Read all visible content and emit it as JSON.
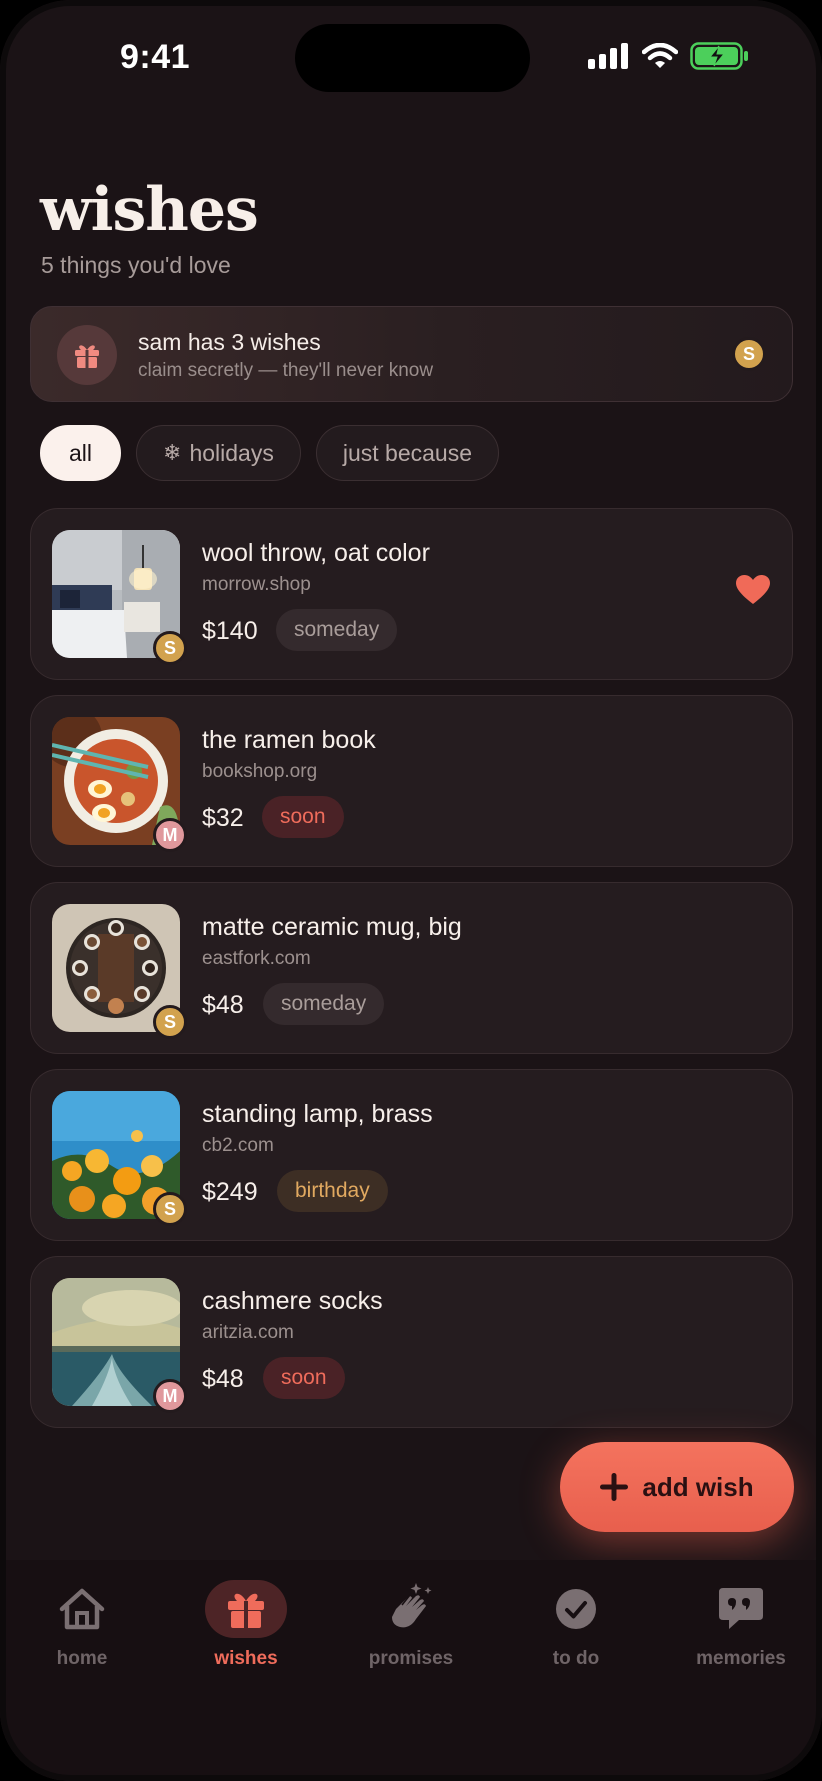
{
  "status": {
    "time": "9:41"
  },
  "header": {
    "title": "wishes",
    "subtitle": "5 things you'd love"
  },
  "banner": {
    "title": "sam has 3 wishes",
    "subtitle": "claim secretly — they'll never know",
    "avatar": "S"
  },
  "filters": [
    {
      "label": "all",
      "active": true
    },
    {
      "label": "holidays",
      "icon": "❄"
    },
    {
      "label": "just because"
    }
  ],
  "wishes": [
    {
      "name": "wool throw, oat color",
      "store": "morrow.shop",
      "price": "$140",
      "tag": "someday",
      "owner": "S",
      "favorited": true,
      "image": "bedroom-photo"
    },
    {
      "name": "the ramen book",
      "store": "bookshop.org",
      "price": "$32",
      "tag": "soon",
      "owner": "M",
      "image": "ramen-photo"
    },
    {
      "name": "matte ceramic mug, big",
      "store": "eastfork.com",
      "price": "$48",
      "tag": "someday",
      "owner": "S",
      "image": "coffee-table-photo"
    },
    {
      "name": "standing lamp, brass",
      "store": "cb2.com",
      "price": "$249",
      "tag": "birthday",
      "owner": "S",
      "image": "flowers-photo"
    },
    {
      "name": "cashmere socks",
      "store": "aritzia.com",
      "price": "$48",
      "tag": "soon",
      "owner": "M",
      "image": "sea-photo"
    }
  ],
  "add_button": {
    "label": "add wish"
  },
  "tabs": [
    {
      "label": "home",
      "icon": "home-icon"
    },
    {
      "label": "wishes",
      "icon": "gift-icon",
      "active": true
    },
    {
      "label": "promises",
      "icon": "clapping-hands-icon"
    },
    {
      "label": "to do",
      "icon": "check-circle-icon"
    },
    {
      "label": "memories",
      "icon": "quote-bubble-icon"
    }
  ],
  "colors": {
    "background": "#1b1316",
    "accent": "#ef6c5b",
    "card": "#251c1f",
    "gold": "#d2a24e"
  }
}
